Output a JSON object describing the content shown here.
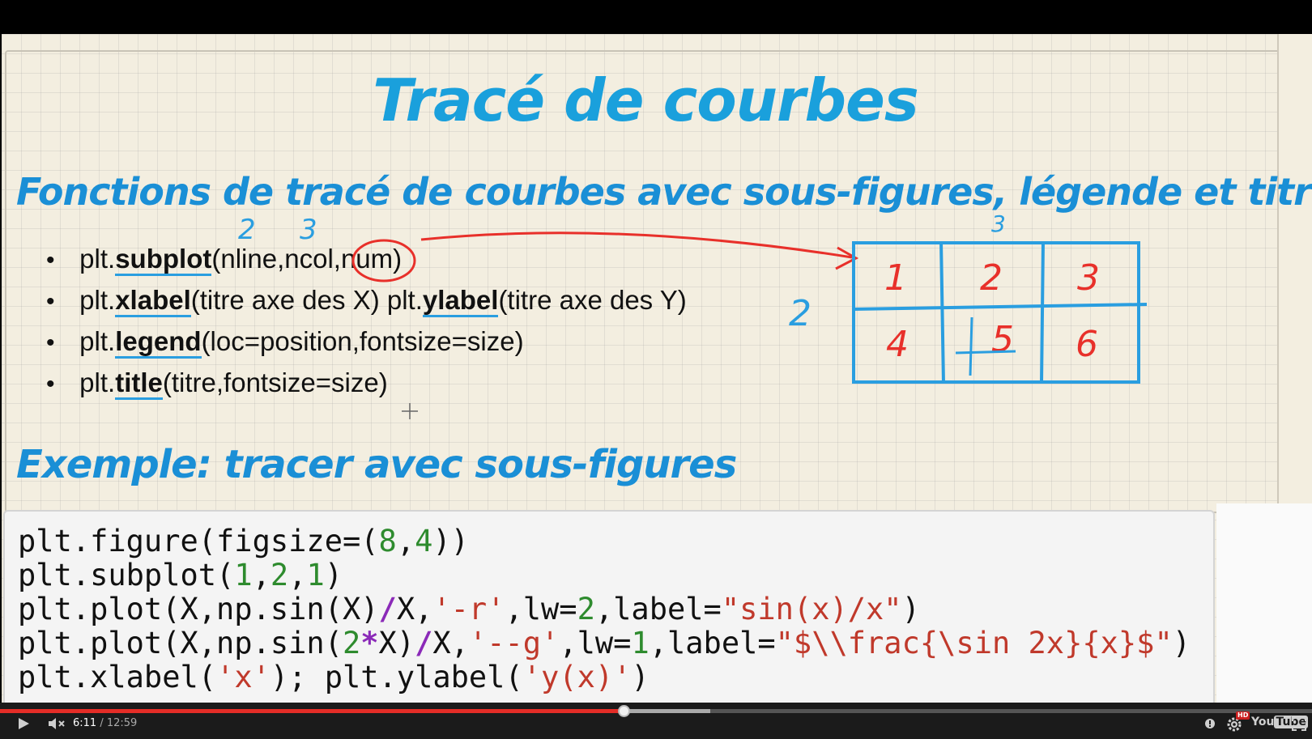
{
  "slide": {
    "title": "Tracé de courbes",
    "subtitle": "Fonctions de tracé de courbes avec sous-figures, légende et titre",
    "bullets": [
      {
        "prefix": "plt.",
        "func": "subplot",
        "args": "(nline,ncol,num)"
      },
      {
        "prefix": "plt.",
        "func": "xlabel",
        "args": "(titre axe des X) plt.",
        "func2": "ylabel",
        "args2": "(titre axe des Y)"
      },
      {
        "prefix": "plt.",
        "func": "legend",
        "args": "(loc=position,fontsize=size)"
      },
      {
        "prefix": "plt.",
        "func": "title",
        "args": "(titre,fontsize=size)"
      }
    ],
    "annotations": {
      "above_nline": "2",
      "above_ncol": "3",
      "grid_cols_label": "3",
      "grid_rows_label": "2",
      "grid_cells": [
        "1",
        "2",
        "3",
        "4",
        "5",
        "6"
      ]
    },
    "example_title": "Exemple: tracer avec sous-figures"
  },
  "code": {
    "lines": [
      "plt.figure(figsize=(8,4))",
      "plt.subplot(1,2,1)",
      "plt.plot(X,np.sin(X)/X,'-r',lw=2,label=\"sin(x)/x\")",
      "plt.plot(X,np.sin(2*X)/X,'--g',lw=1,label=\"$\\\\frac{\\sin 2x}{x}$\")",
      "plt.xlabel('x'); plt.ylabel('y(x)')"
    ]
  },
  "player": {
    "current_time": "6:11",
    "separator": " / ",
    "total_time": "12:59",
    "progress": 0.476,
    "hd_label": "HD",
    "logo_you": "You",
    "logo_tube": "Tube"
  },
  "colors": {
    "title_blue": "#1aa0dc",
    "annotation_red": "#e8302a",
    "progress_red": "#e52d27"
  }
}
